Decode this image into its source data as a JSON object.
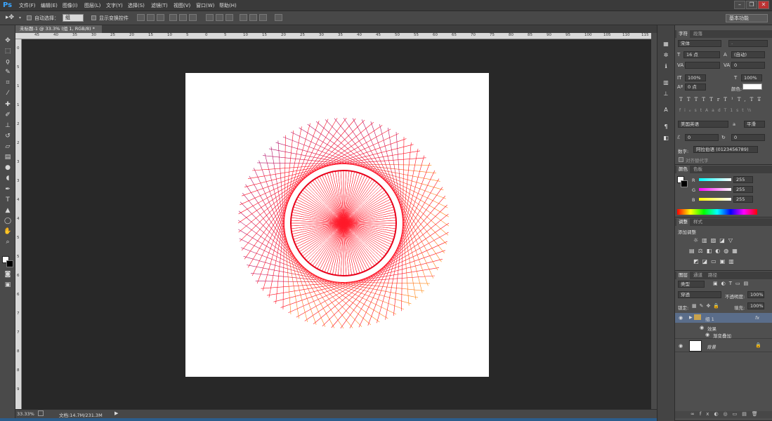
{
  "app": {
    "logo": "Ps"
  },
  "menu": [
    "文件(F)",
    "编辑(E)",
    "图像(I)",
    "图层(L)",
    "文字(Y)",
    "选择(S)",
    "滤镜(T)",
    "视图(V)",
    "窗口(W)",
    "帮助(H)"
  ],
  "options": {
    "auto_select_label": "自动选择：",
    "auto_select_value": "组",
    "show_transform_label": "显示变换控件",
    "workspace": "基本功能"
  },
  "document": {
    "tab_title": "未标题-1 @ 33.3% (组 1, RGB/8) *",
    "zoom": "33.33%",
    "doc_info": "文档:14.7M/231.3M"
  },
  "ruler": {
    "h": [
      "45",
      "40",
      "35",
      "30",
      "25",
      "20",
      "15",
      "10",
      "5",
      "0",
      "5",
      "10",
      "15",
      "20",
      "25",
      "30",
      "35",
      "40",
      "45",
      "50",
      "55",
      "60",
      "65",
      "70",
      "75",
      "80",
      "85",
      "90",
      "95",
      "100",
      "105",
      "110",
      "115",
      "120"
    ],
    "v": [
      "0",
      "5",
      "1",
      "1",
      "2",
      "2",
      "3",
      "3",
      "4",
      "4",
      "5",
      "5",
      "6",
      "6",
      "7",
      "7",
      "8",
      "8",
      "9"
    ]
  },
  "character": {
    "tab_char": "字符",
    "tab_para": "段落",
    "font": "宋体",
    "font_style": "-",
    "size": "16 点",
    "leading": "(自动)",
    "kerning": "",
    "tracking": "0",
    "vscale": "100%",
    "hscale": "100%",
    "baseline": "0 点",
    "color_label": "颜色:",
    "language": "美国英语",
    "aa": "a",
    "aa_value": "平滑",
    "num_a": "0",
    "num_b": "0",
    "digits_label": "数字:",
    "digits_value": "阿拉伯语 (0123456789)",
    "align_label": "对齐替代字",
    "style_glyphs": [
      "T",
      "T",
      "TT",
      "Tr",
      "T¹",
      "T,",
      "T",
      "T̶"
    ],
    "ot_glyphs": [
      "fi",
      "ℴ",
      "st",
      "A",
      "ad",
      "T",
      "1st",
      "½"
    ]
  },
  "color": {
    "tab_color": "颜色",
    "tab_swatches": "色板",
    "r_label": "R",
    "g_label": "G",
    "b_label": "B",
    "r": "255",
    "g": "255",
    "b": "255"
  },
  "adjust": {
    "tab_adjust": "调整",
    "tab_style": "样式",
    "title": "添加调整"
  },
  "layers": {
    "tab_layers": "图层",
    "tab_channels": "通道",
    "tab_paths": "路径",
    "kind": "类型",
    "blend": "穿透",
    "opacity_label": "不透明度:",
    "opacity": "100%",
    "lock_label": "锁定:",
    "fill_label": "填充:",
    "fill": "100%",
    "rows": [
      {
        "name": "组 1",
        "fx": "fx"
      },
      {
        "name": "效果"
      },
      {
        "name": "渐变叠加"
      },
      {
        "name": "背景"
      }
    ]
  }
}
